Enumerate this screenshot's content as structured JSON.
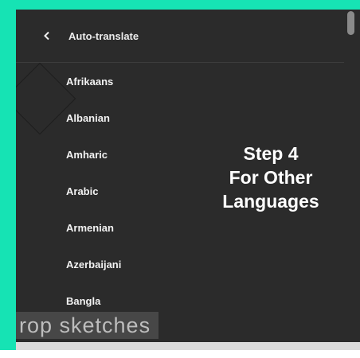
{
  "header": {
    "title": "Auto-translate",
    "back_icon": "chevron-left-icon"
  },
  "languages": [
    {
      "label": "Afrikaans"
    },
    {
      "label": "Albanian"
    },
    {
      "label": "Amharic"
    },
    {
      "label": "Arabic"
    },
    {
      "label": "Armenian"
    },
    {
      "label": "Azerbaijani"
    },
    {
      "label": "Bangla"
    }
  ],
  "overlay": {
    "line1": "Step 4",
    "line2": "For Other",
    "line3": "Languages"
  },
  "watermark": {
    "text": "rop sketches"
  },
  "colors": {
    "frame": "#16e3b4",
    "panel": "#2b2b2b",
    "text": "#f2f2f2"
  }
}
